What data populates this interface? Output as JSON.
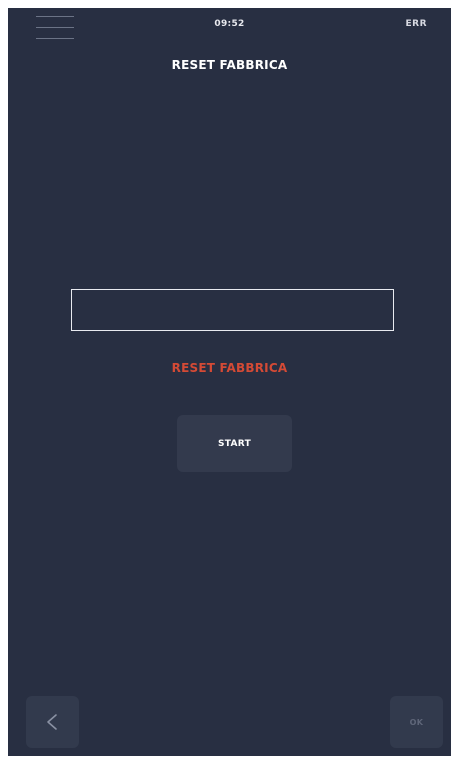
{
  "header": {
    "menu_icon": "hamburger-menu-icon",
    "time": "09:52",
    "status": "ERR",
    "title": "RESET FABBRICA"
  },
  "main": {
    "progress_box_value": "",
    "status_text": "RESET FABBRICA",
    "status_color": "#d44a35",
    "start_label": "START"
  },
  "footer": {
    "back_icon": "chevron-left-icon",
    "ok_label": "OK"
  },
  "colors": {
    "background": "#282f42",
    "button_bg": "#333a4d",
    "text": "#ffffff",
    "error_red": "#d44a35"
  }
}
